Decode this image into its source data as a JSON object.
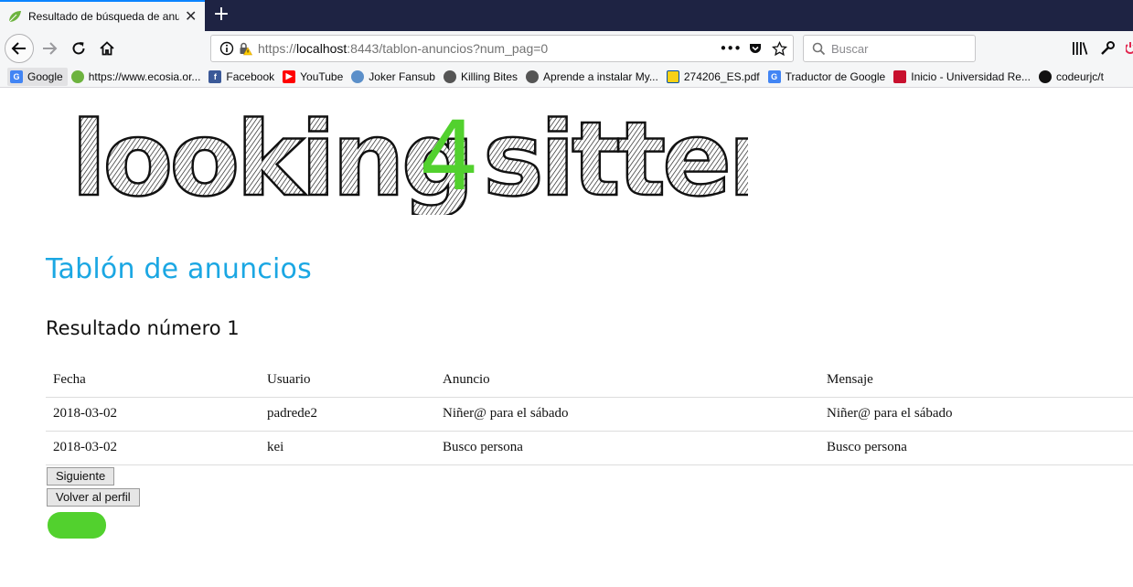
{
  "browser": {
    "tab_title": "Resultado de búsqueda de anuncios",
    "url_scheme": "https://",
    "url_host": "localhost",
    "url_rest": ":8443/tablon-anuncios?num_pag=0",
    "search_placeholder": "Buscar",
    "bookmarks": [
      {
        "label": "Google",
        "icon": "google-icon",
        "color": "#4285f4",
        "glyph": "G"
      },
      {
        "label": "https://www.ecosia.or...",
        "icon": "ecosia-icon",
        "color": "#6db33f",
        "glyph": ""
      },
      {
        "label": "Facebook",
        "icon": "facebook-icon",
        "color": "#3b5998",
        "glyph": "f"
      },
      {
        "label": "YouTube",
        "icon": "youtube-icon",
        "color": "#ff0000",
        "glyph": "▶"
      },
      {
        "label": "Joker Fansub",
        "icon": "joker-fansub-icon",
        "color": "#5b8fc9",
        "glyph": ""
      },
      {
        "label": "Killing Bites",
        "icon": "globe-icon",
        "color": "#555555",
        "glyph": ""
      },
      {
        "label": "Aprende a instalar My...",
        "icon": "globe-icon",
        "color": "#555555",
        "glyph": ""
      },
      {
        "label": "274206_ES.pdf",
        "icon": "lidl-icon",
        "color": "#f7d117",
        "glyph": ""
      },
      {
        "label": "Traductor de Google",
        "icon": "translate-icon",
        "color": "#4285f4",
        "glyph": "G"
      },
      {
        "label": "Inicio - Universidad Re...",
        "icon": "urjc-icon",
        "color": "#c8102e",
        "glyph": ""
      },
      {
        "label": "codeurjc/t",
        "icon": "github-icon",
        "color": "#111111",
        "glyph": ""
      }
    ]
  },
  "page": {
    "logo_text_left": "looking",
    "logo_text_digit": "4",
    "logo_text_right": "sitter",
    "title": "Tablón de anuncios",
    "result_heading": "Resultado número 1",
    "table": {
      "headers": [
        "Fecha",
        "Usuario",
        "Anuncio",
        "Mensaje"
      ],
      "rows": [
        [
          "2018-03-02",
          "padrede2",
          "Niñer@ para el sábado",
          "Niñer@ para el sábado"
        ],
        [
          "2018-03-02",
          "kei",
          "Busco persona",
          "Busco persona"
        ]
      ]
    },
    "next_button": "Siguiente",
    "back_button": "Volver al perfil"
  },
  "colors": {
    "title": "#1ba7e3",
    "logo_accent": "#52d12e",
    "green_button": "#52d12e",
    "tabbar": "#1e2343"
  }
}
